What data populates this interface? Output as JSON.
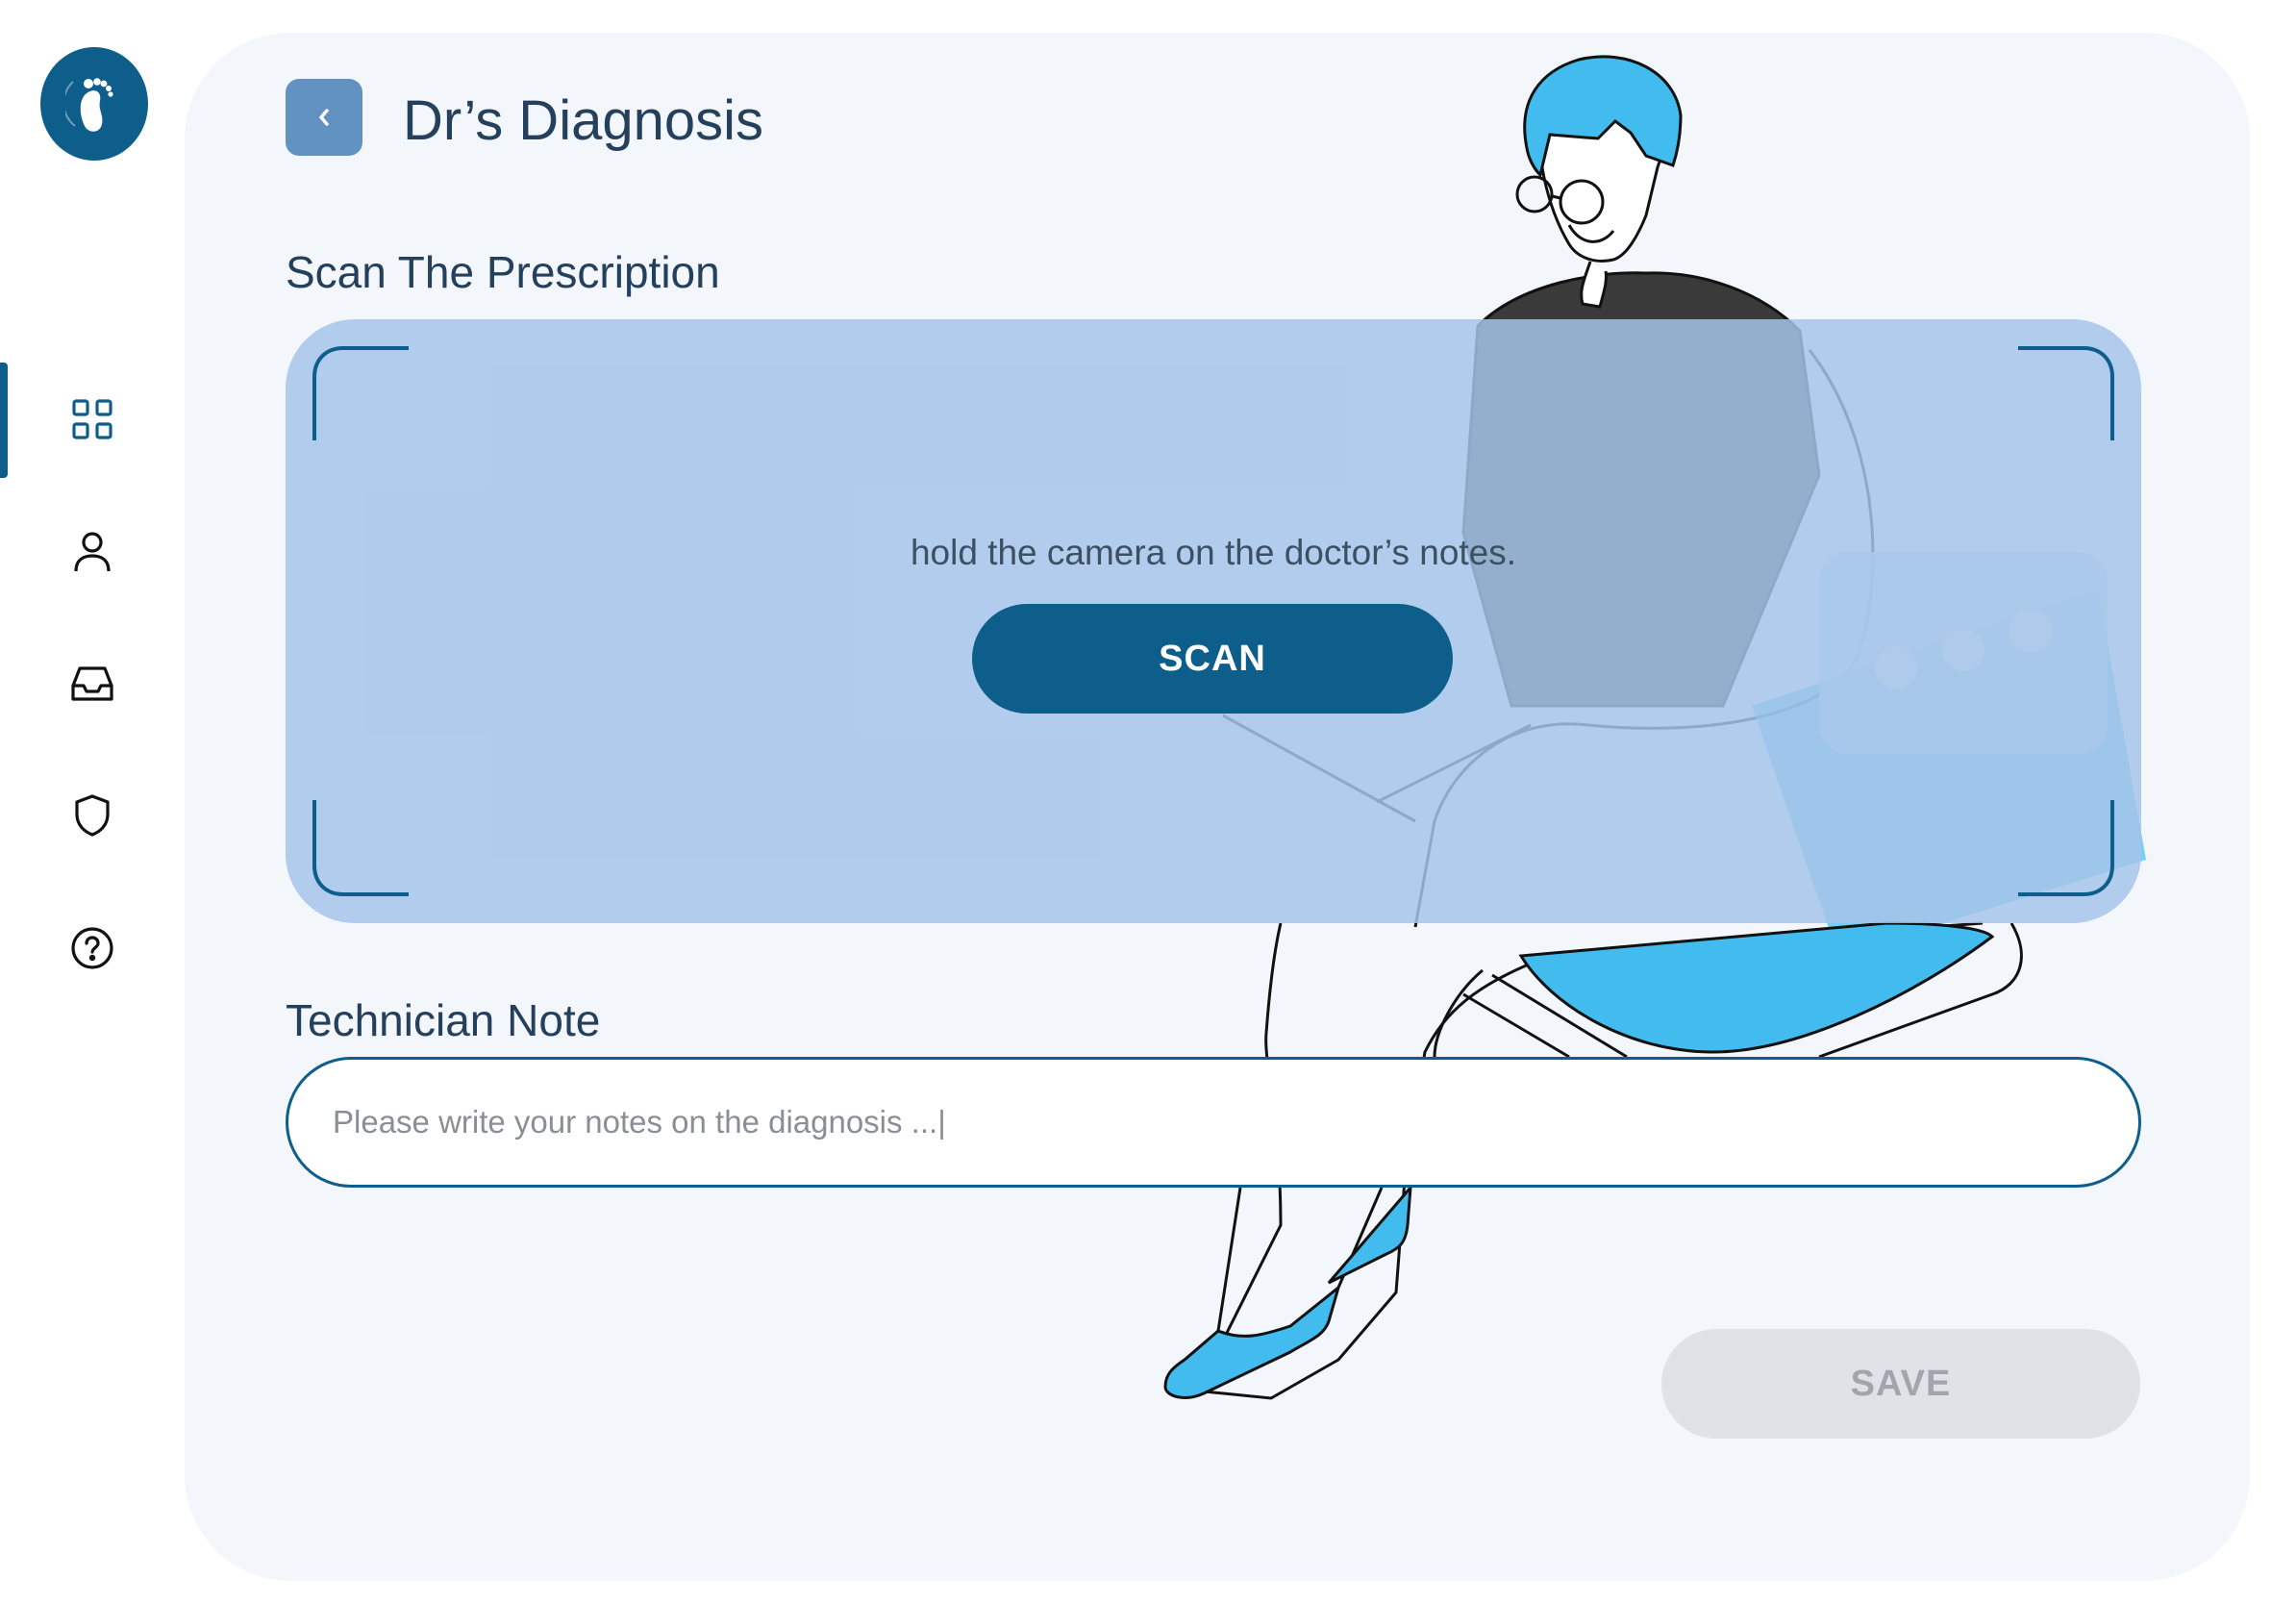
{
  "app": {
    "logo_icon": "footprint-icon",
    "accent_color": "#0e5e8c"
  },
  "sidebar": {
    "items": [
      {
        "name": "dashboard",
        "icon": "grid-icon",
        "active": true
      },
      {
        "name": "profile",
        "icon": "user-icon",
        "active": false
      },
      {
        "name": "inbox",
        "icon": "inbox-icon",
        "active": false
      },
      {
        "name": "security",
        "icon": "shield-icon",
        "active": false
      },
      {
        "name": "help",
        "icon": "help-circle-icon",
        "active": false
      }
    ]
  },
  "header": {
    "back_icon": "chevron-left-icon",
    "title": "Dr’s Diagnosis"
  },
  "scan": {
    "section_title": "Scan The Prescription",
    "instruction": "hold the camera on the doctor’s notes.",
    "button_label": "SCAN"
  },
  "note": {
    "section_title": "Technician Note",
    "placeholder": "Please write your notes on the diagnosis ...|"
  },
  "actions": {
    "save_label": "SAVE",
    "save_enabled": false
  },
  "colors": {
    "primary": "#0e5e8c",
    "back_button": "#6192c2",
    "scan_overlay": "#a4c4e9",
    "illustration_blue": "#42bcef",
    "disabled": "#dfe2e7"
  }
}
